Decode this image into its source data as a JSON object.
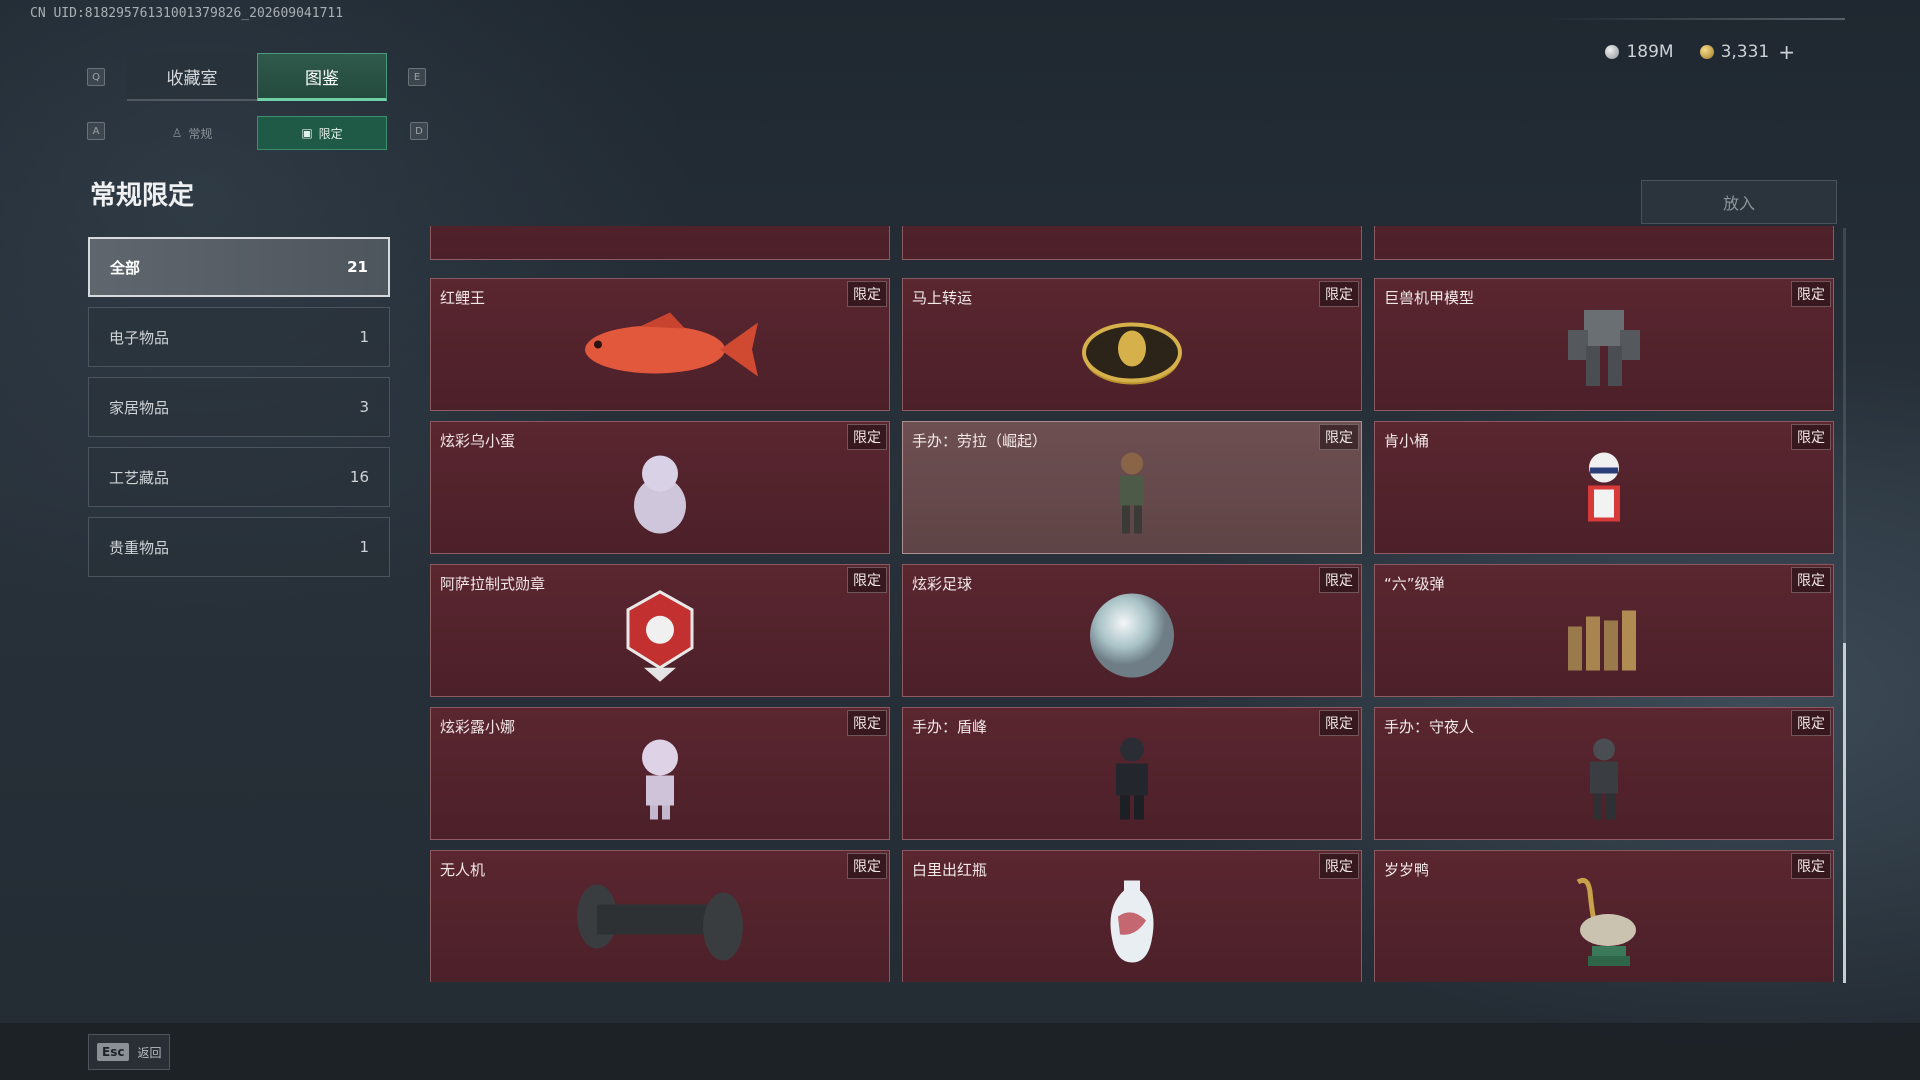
{
  "uid": "CN UID:8182957613100137982‌6_202609041711",
  "currency": {
    "silver": "189M",
    "gold": "3,331",
    "plus": "+"
  },
  "keys": {
    "q": "Q",
    "e": "E",
    "a": "A",
    "d": "D"
  },
  "top_tabs": [
    {
      "label": "收藏室"
    },
    {
      "label": "图鉴"
    }
  ],
  "sub_tabs": [
    {
      "label": "常规"
    },
    {
      "label": "限定"
    }
  ],
  "page_title": "常规限定",
  "put_button": "放入",
  "categories": [
    {
      "label": "全部",
      "count": "21"
    },
    {
      "label": "电子物品",
      "count": "1"
    },
    {
      "label": "家居物品",
      "count": "3"
    },
    {
      "label": "工艺藏品",
      "count": "16"
    },
    {
      "label": "贵重物品",
      "count": "1"
    }
  ],
  "tag_label": "限定",
  "items": [
    {
      "name": "红鲤王"
    },
    {
      "name": "马上转运"
    },
    {
      "name": "巨兽机甲模型"
    },
    {
      "name": "炫彩乌小蛋"
    },
    {
      "name": "手办：劳拉（崛起）"
    },
    {
      "name": "肯小桶"
    },
    {
      "name": "阿萨拉制式勋章"
    },
    {
      "name": "炫彩足球"
    },
    {
      "name": "“六”级弹"
    },
    {
      "name": "炫彩露小娜"
    },
    {
      "name": "手办：盾峰"
    },
    {
      "name": "手办：守夜人"
    },
    {
      "name": "无人机"
    },
    {
      "name": "白里出红瓶"
    },
    {
      "name": "岁岁鸭"
    }
  ],
  "back": {
    "key": "Esc",
    "label": "返回"
  },
  "colors": {
    "accent_green": "#6fd0a5",
    "card_red": "#5a2630"
  }
}
